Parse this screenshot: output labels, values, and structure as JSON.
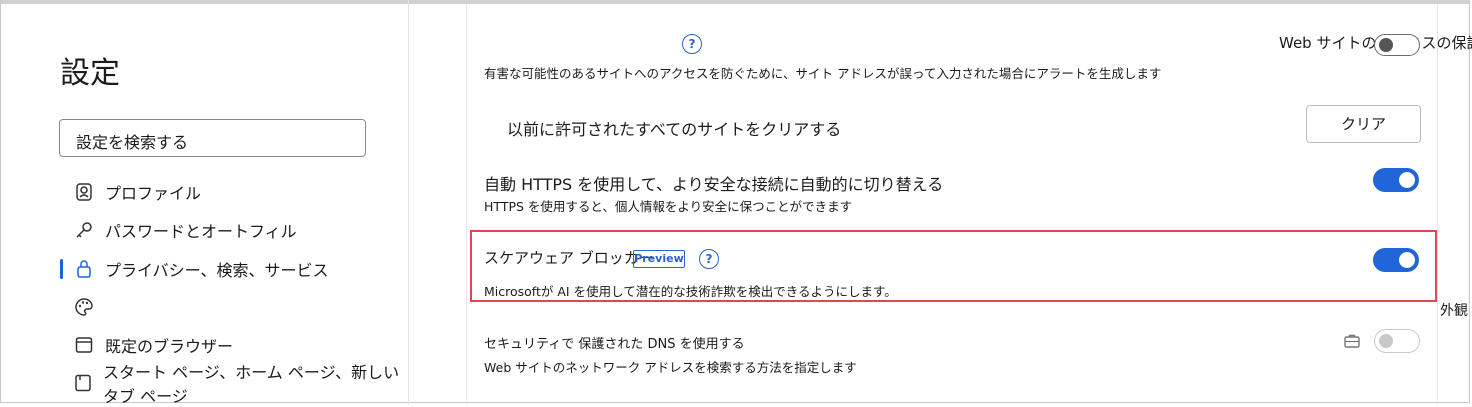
{
  "sidebar": {
    "title": "設定",
    "search_placeholder": "設定を検索する",
    "items": [
      {
        "label": "プロファイル",
        "icon": "profile-icon"
      },
      {
        "label": "パスワードとオートフィル",
        "icon": "key-icon"
      },
      {
        "label": "プライバシー、検索、サービス",
        "icon": "lock-icon",
        "active": true
      },
      {
        "label": "",
        "icon": "palette-icon"
      },
      {
        "label": "既定のブラウザー",
        "icon": "browser-icon"
      },
      {
        "label": "スタート ページ、ホーム ページ、新しいタブ ページ",
        "icon": "start-page-icon"
      }
    ]
  },
  "main": {
    "typo_protection": {
      "title_partial": "Web サイトの入力ミスの保護",
      "description": "有害な可能性のあるサイトへのアクセスを防ぐために、サイト アドレスが誤って入力された場合にアラートを生成します"
    },
    "clear_sites": {
      "label": "以前に許可されたすべてのサイトをクリアする",
      "button": "クリア"
    },
    "auto_https": {
      "label": "自動 HTTPS を使用して、より安全な接続に自動的に切り替える",
      "description": "HTTPS を使用すると、個人情報をより安全に保つことができます",
      "enabled": true
    },
    "scareware": {
      "label": "スケアウェア ブロッカー",
      "badge": "Preview",
      "description": "Microsoftが AI を使用して潜在的な技術詐欺を検出できるようにします。",
      "enabled": true
    },
    "secure_dns": {
      "label": "セキュリティで 保護された DNS を使用する",
      "description": "Web サイトのネットワーク アドレスを検索する方法を指定します",
      "enabled": false
    },
    "side_label": "外観"
  },
  "colors": {
    "accent": "#1f64d8",
    "highlight": "#e0484d"
  }
}
